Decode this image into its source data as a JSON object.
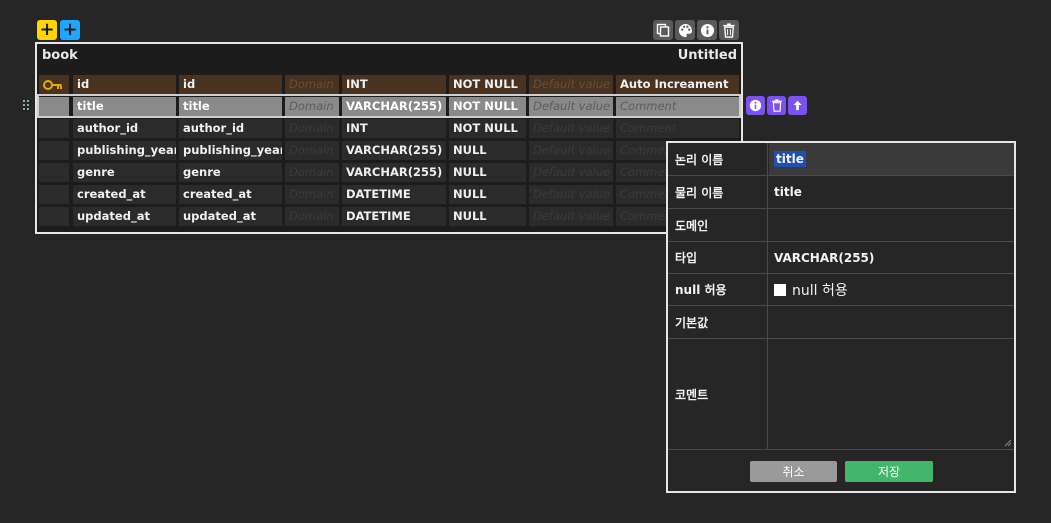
{
  "toolbar": {
    "add_table_icon": "plus-icon",
    "add_memo_icon": "plus-icon",
    "colors": {
      "add_table": "#ffd400",
      "add_memo": "#1ea7ff"
    }
  },
  "table_tools": [
    "copy-icon",
    "palette-icon",
    "info-icon",
    "trash-icon"
  ],
  "table": {
    "name": "book",
    "comment": "Untitled",
    "placeholders": {
      "domain": "Domain",
      "default": "Default value",
      "comment": "Comment"
    },
    "columns": [
      {
        "key": "pk",
        "logical": "id",
        "physical": "id",
        "domain": "",
        "type": "INT",
        "nullable": "NOT NULL",
        "default": "",
        "comment": "Auto Increament"
      },
      {
        "key": "",
        "logical": "title",
        "physical": "title",
        "domain": "",
        "type": "VARCHAR(255)",
        "nullable": "NOT NULL",
        "default": "",
        "comment": ""
      },
      {
        "key": "",
        "logical": "author_id",
        "physical": "author_id",
        "domain": "",
        "type": "INT",
        "nullable": "NOT NULL",
        "default": "",
        "comment": ""
      },
      {
        "key": "",
        "logical": "publishing_year",
        "physical": "publishing_year",
        "domain": "",
        "type": "VARCHAR(255)",
        "nullable": "NULL",
        "default": "",
        "comment": ""
      },
      {
        "key": "",
        "logical": "genre",
        "physical": "genre",
        "domain": "",
        "type": "VARCHAR(255)",
        "nullable": "NULL",
        "default": "",
        "comment": ""
      },
      {
        "key": "",
        "logical": "created_at",
        "physical": "created_at",
        "domain": "",
        "type": "DATETIME",
        "nullable": "NULL",
        "default": "",
        "comment": ""
      },
      {
        "key": "",
        "logical": "updated_at",
        "physical": "updated_at",
        "domain": "",
        "type": "DATETIME",
        "nullable": "NULL",
        "default": "",
        "comment": ""
      }
    ],
    "selected_index": 1
  },
  "row_tools": [
    "info-icon",
    "trash-icon",
    "arrow-up-icon"
  ],
  "detail_panel": {
    "logical_name_label": "논리 이름",
    "logical_name_value": "title",
    "physical_name_label": "물리 이름",
    "physical_name_value": "title",
    "domain_label": "도메인",
    "domain_value": "",
    "type_label": "타입",
    "type_value": "VARCHAR(255)",
    "nullable_label": "null 허용",
    "nullable_checkbox_text": "null 허용",
    "nullable_checked": false,
    "default_label": "기본값",
    "default_value": "",
    "comment_label": "코멘트",
    "comment_value": "",
    "cancel_label": "취소",
    "save_label": "저장"
  }
}
